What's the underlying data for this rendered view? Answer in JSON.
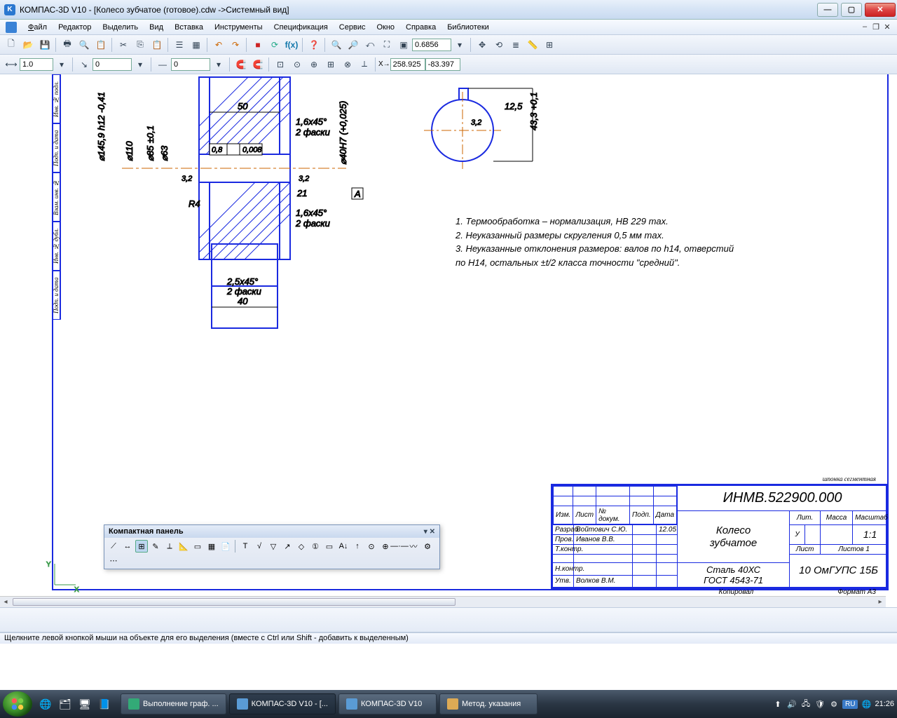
{
  "window": {
    "title": "КОМПАС-3D V10 - [Колесо зубчатое (готовое).cdw ->Системный вид]",
    "min": "—",
    "max": "▢",
    "close": "✕"
  },
  "menu": {
    "items": [
      "Файл",
      "Редактор",
      "Выделить",
      "Вид",
      "Вставка",
      "Инструменты",
      "Спецификация",
      "Сервис",
      "Окно",
      "Справка",
      "Библиотеки"
    ]
  },
  "toolbar2": {
    "step": "1.0",
    "style": "0",
    "offset": "0",
    "zoom": "0.6856",
    "coordX": "258.925",
    "coordY": "-83.397"
  },
  "notes": {
    "l1": "1. Термообработка – нормализация, HB 229 max.",
    "l2": "2. Неуказанный размеры скругления 0,5 мм max.",
    "l3": "3. Неуказанные отклонения размеров: валов по h14, отверстий",
    "l4": "   по H14, остальных ±t/2 класса точности \"средний\"."
  },
  "titleblock": {
    "code": "ИНМВ.522900.000",
    "name1": "Колесо",
    "name2": "зубчатое",
    "material1": "Сталь 40ХС",
    "material2": "ГОСТ 4543-71",
    "org": "10 ОмГУПС 15Б",
    "scale": "1:1",
    "lit": "У",
    "sheet": "Лист",
    "sheets": "Листов   1",
    "mass": "Масса",
    "scalew": "Масштаб",
    "litw": "Лит.",
    "rows": {
      "izm": "Изм.",
      "list": "Лист",
      "ndoc": "№ докум.",
      "podp": "Подп.",
      "data": "Дата",
      "razrab": "Разраб.",
      "razrab_n": "Войтович С.Ю.",
      "razrab_d": "12.05",
      "prov": "Пров.",
      "prov_n": "Иванов В.В.",
      "tcontr": "Т.контр.",
      "ncontr": "Н.контр.",
      "utv": "Утв.",
      "utv_n": "Волков В.М."
    },
    "kopiroval": "Копировал",
    "format": "Формат    А3",
    "shanko": "шпонка сегментная"
  },
  "leftstrip": [
    "Подп. и дата",
    "Инв. № дубл.",
    "Взам. инв. №",
    "Подп. и дата",
    "Инв. № подл."
  ],
  "dims": {
    "d50": "50",
    "d40": "40",
    "d21": "21",
    "chamfer16": "1,6x45°",
    "faski2": "2 фаски",
    "chamfer25": "2,5x45°",
    "r4": "R4",
    "ra32": "3,2",
    "ra08": "0,8",
    "tol008": "0,008",
    "d145": "⌀145,9 h12 -0,41",
    "d85": "⌀85 ±0,1",
    "d63": "⌀63",
    "d110": "⌀110",
    "d40h7": "⌀40H7 (+0,025)",
    "a_mark": "А",
    "d125": "12,5",
    "v43": "43,3 +0,1",
    "ra32b": "3,2"
  },
  "panel": {
    "title": "Компактная панель"
  },
  "status": {
    "text": "Щелкните левой кнопкой мыши на объекте для его выделения (вместе с Ctrl или Shift - добавить к выделенным)"
  },
  "taskbar": {
    "items": [
      {
        "label": "Выполнение граф. ...",
        "active": false
      },
      {
        "label": "КОМПАС-3D V10 - [...",
        "active": true
      },
      {
        "label": "КОМПАС-3D V10",
        "active": false
      },
      {
        "label": "Метод. указания",
        "active": false
      }
    ],
    "lang": "RU",
    "time": "21:26"
  }
}
